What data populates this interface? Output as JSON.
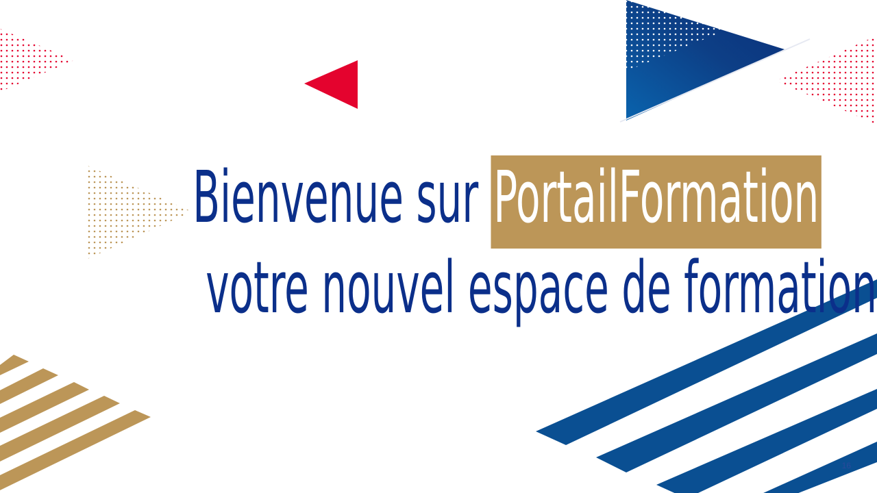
{
  "slide": {
    "title_prefix": "Bienvenue sur ",
    "title_highlight": "PortailFormation",
    "subtitle": "votre nouvel espace de formation",
    "page_number": "16"
  },
  "colors": {
    "navy": "#0b2f8a",
    "blue_stripe": "#0a4f92",
    "gold": "#bc9658",
    "red": "#e4032e",
    "white": "#ffffff"
  },
  "decorations": [
    "red-dotted-triangle-icon",
    "red-triangle-icon",
    "blue-gradient-triangle-icon",
    "gold-dotted-triangle-icon",
    "gold-stripes",
    "blue-stripes"
  ]
}
